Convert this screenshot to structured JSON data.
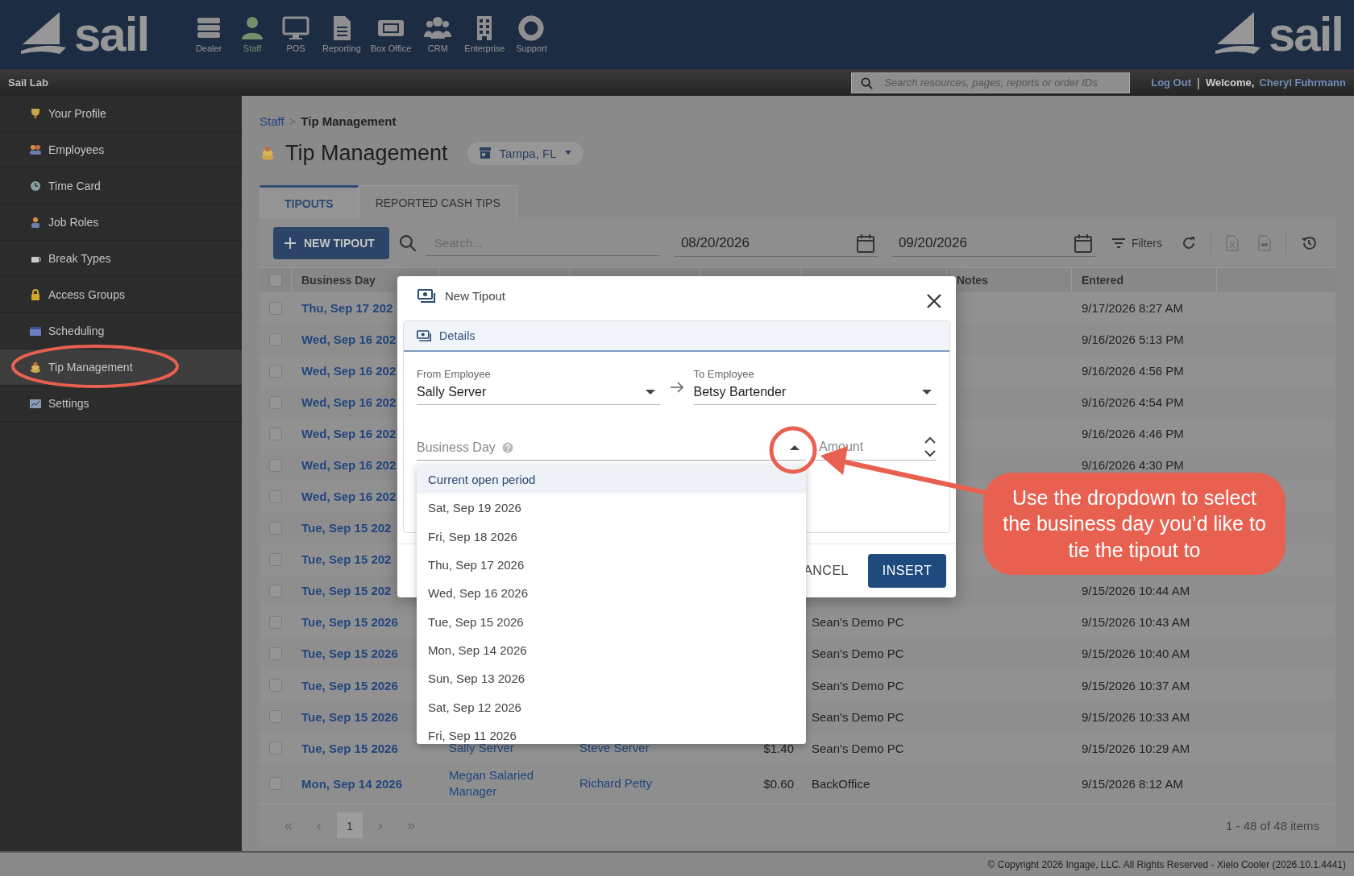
{
  "header": {
    "logo": "sail",
    "logo_right": "sail",
    "nav": [
      {
        "label": "Dealer",
        "selected": false
      },
      {
        "label": "Staff",
        "selected": true
      },
      {
        "label": "POS",
        "selected": false
      },
      {
        "label": "Reporting",
        "selected": false
      },
      {
        "label": "Box Office",
        "selected": false
      },
      {
        "label": "CRM",
        "selected": false
      },
      {
        "label": "Enterprise",
        "selected": false
      },
      {
        "label": "Support",
        "selected": false
      }
    ]
  },
  "subheader": {
    "site": "Sail Lab",
    "search": {
      "placeholder": "Search resources, pages, reports or order IDs"
    },
    "logout": "Log Out",
    "separator": "|",
    "welcome": "Welcome,",
    "user": "Cheryl Fuhrmann"
  },
  "sidebar": {
    "items": [
      {
        "label": "Your Profile",
        "selected": false
      },
      {
        "label": "Employees",
        "selected": false
      },
      {
        "label": "Time Card",
        "selected": false
      },
      {
        "label": "Job Roles",
        "selected": false
      },
      {
        "label": "Break Types",
        "selected": false
      },
      {
        "label": "Access Groups",
        "selected": false
      },
      {
        "label": "Scheduling",
        "selected": false
      },
      {
        "label": "Tip Management",
        "selected": true
      },
      {
        "label": "Settings",
        "selected": false
      }
    ]
  },
  "breadcrumb": {
    "items": [
      "Staff",
      "Tip Management"
    ],
    "separator": ">"
  },
  "page_title": "Tip Management",
  "location": "Tampa, FL",
  "tabs": [
    {
      "label": "TIPOUTS",
      "selected": true
    },
    {
      "label": "REPORTED CASH TIPS",
      "selected": false
    }
  ],
  "toolbar": {
    "new_button": "NEW TIPOUT",
    "search": {
      "placeholder": "Search..."
    },
    "start_date": "08/20/2026",
    "end_date": "09/20/2026",
    "filters": "Filters"
  },
  "table": {
    "select_all_checked": false,
    "columns": {
      "business_day": "Business Day",
      "notes": "Notes",
      "entered": "Entered"
    },
    "rows": [
      {
        "checked": false,
        "business_day": "Thu, Sep 17 202",
        "entered": "9/17/2026 8:27 AM"
      },
      {
        "checked": false,
        "business_day": "Wed, Sep 16 202",
        "entered": "9/16/2026 5:13 PM"
      },
      {
        "checked": false,
        "business_day": "Wed, Sep 16 202",
        "entered": "9/16/2026 4:56 PM"
      },
      {
        "checked": false,
        "business_day": "Wed, Sep 16 202",
        "entered": "9/16/2026 4:54 PM"
      },
      {
        "checked": false,
        "business_day": "Wed, Sep 16 202",
        "entered": "9/16/2026 4:46 PM"
      },
      {
        "checked": false,
        "business_day": "Wed, Sep 16 202",
        "entered": "9/16/2026 4:30 PM"
      },
      {
        "checked": false,
        "business_day": "Wed, Sep 16 202"
      },
      {
        "checked": false,
        "business_day": "Tue, Sep 15 202"
      },
      {
        "checked": false,
        "business_day": "Tue, Sep 15 202"
      },
      {
        "checked": false,
        "business_day": "Tue, Sep 15 202",
        "entered": "9/15/2026 10:44 AM"
      },
      {
        "checked": false,
        "business_day": "Tue, Sep 15 2026",
        "source": "Sean's Demo PC",
        "entered": "9/15/2026 10:43 AM"
      },
      {
        "checked": false,
        "business_day": "Tue, Sep 15 2026",
        "source": "Sean's Demo PC",
        "entered": "9/15/2026 10:40 AM"
      },
      {
        "checked": false,
        "business_day": "Tue, Sep 15 2026",
        "source": "Sean's Demo PC",
        "entered": "9/15/2026 10:37 AM"
      },
      {
        "checked": false,
        "business_day": "Tue, Sep 15 2026",
        "source": "Sean's Demo PC",
        "entered": "9/15/2026 10:33 AM"
      },
      {
        "checked": false,
        "business_day": "Tue, Sep 15 2026",
        "from": "Sally Server",
        "to": "Steve Server",
        "amount": "$1.40",
        "source": "Sean's Demo PC",
        "entered": "9/15/2026 10:29 AM"
      },
      {
        "checked": false,
        "business_day": "Mon, Sep 14 2026",
        "from": "Megan Salaried Manager",
        "to": "Richard Petty",
        "amount": "$0.60",
        "source": "BackOffice",
        "entered": "9/15/2026 8:12 AM"
      }
    ]
  },
  "pager": {
    "first": "«",
    "prev": "‹",
    "pages": [
      {
        "label": "1",
        "selected": true
      }
    ],
    "next": "›",
    "last": "»",
    "summary": "1 - 48 of 48 items"
  },
  "modal": {
    "title": "New Tipout",
    "section": "Details",
    "from": {
      "label": "From Employee",
      "value": "Sally Server"
    },
    "to": {
      "label": "To Employee",
      "value": "Betsy Bartender"
    },
    "business_day": {
      "label": "Business Day",
      "expanded": true
    },
    "amount": {
      "placeholder": "Amount"
    },
    "options": [
      {
        "label": "Current open period",
        "selected": true
      },
      {
        "label": "Sat, Sep 19 2026",
        "selected": false
      },
      {
        "label": "Fri, Sep 18 2026",
        "selected": false
      },
      {
        "label": "Thu, Sep 17 2026",
        "selected": false
      },
      {
        "label": "Wed, Sep 16 2026",
        "selected": false
      },
      {
        "label": "Tue, Sep 15 2026",
        "selected": false
      },
      {
        "label": "Mon, Sep 14 2026",
        "selected": false
      },
      {
        "label": "Sun, Sep 13 2026",
        "selected": false
      },
      {
        "label": "Sat, Sep 12 2026",
        "selected": false
      },
      {
        "label": "Fri, Sep 11 2026",
        "selected": false
      }
    ],
    "cancel": "ANCEL",
    "insert": "INSERT"
  },
  "annotation": {
    "callout": "Use the dropdown to select the business day you’d like to tie the tipout to"
  },
  "footer": "© Copyright 2026 Ingage, LLC. All Rights Reserved - Xielo Cooler (2026.10.1.4441)"
}
